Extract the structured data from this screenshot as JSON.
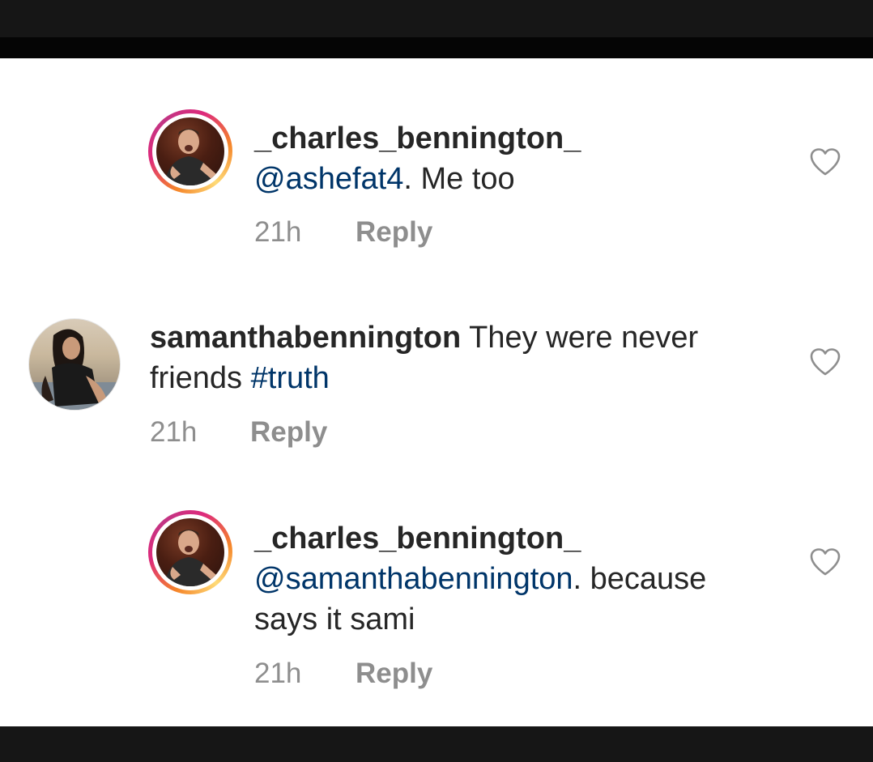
{
  "comments": [
    {
      "username": "_charles_bennington_",
      "mention": "@ashefat4",
      "text": ". Me too",
      "time": "21h",
      "reply_label": "Reply"
    },
    {
      "username": "samanthabennington",
      "text_line1": " They were never",
      "text_line2": "friends ",
      "hashtag": "#truth",
      "time": "21h",
      "reply_label": "Reply"
    },
    {
      "username": "_charles_bennington_",
      "mention": "@samanthabennington",
      "text_line1": ". because",
      "text_line2": "says it sami",
      "time": "21h",
      "reply_label": "Reply"
    }
  ],
  "colors": {
    "mention": "#003569",
    "username": "#262626",
    "meta": "#8e8e8e",
    "story_ring_start": "#f58529",
    "story_ring_end": "#dd2a7b"
  },
  "icons": {
    "like": "heart-outline-icon"
  }
}
